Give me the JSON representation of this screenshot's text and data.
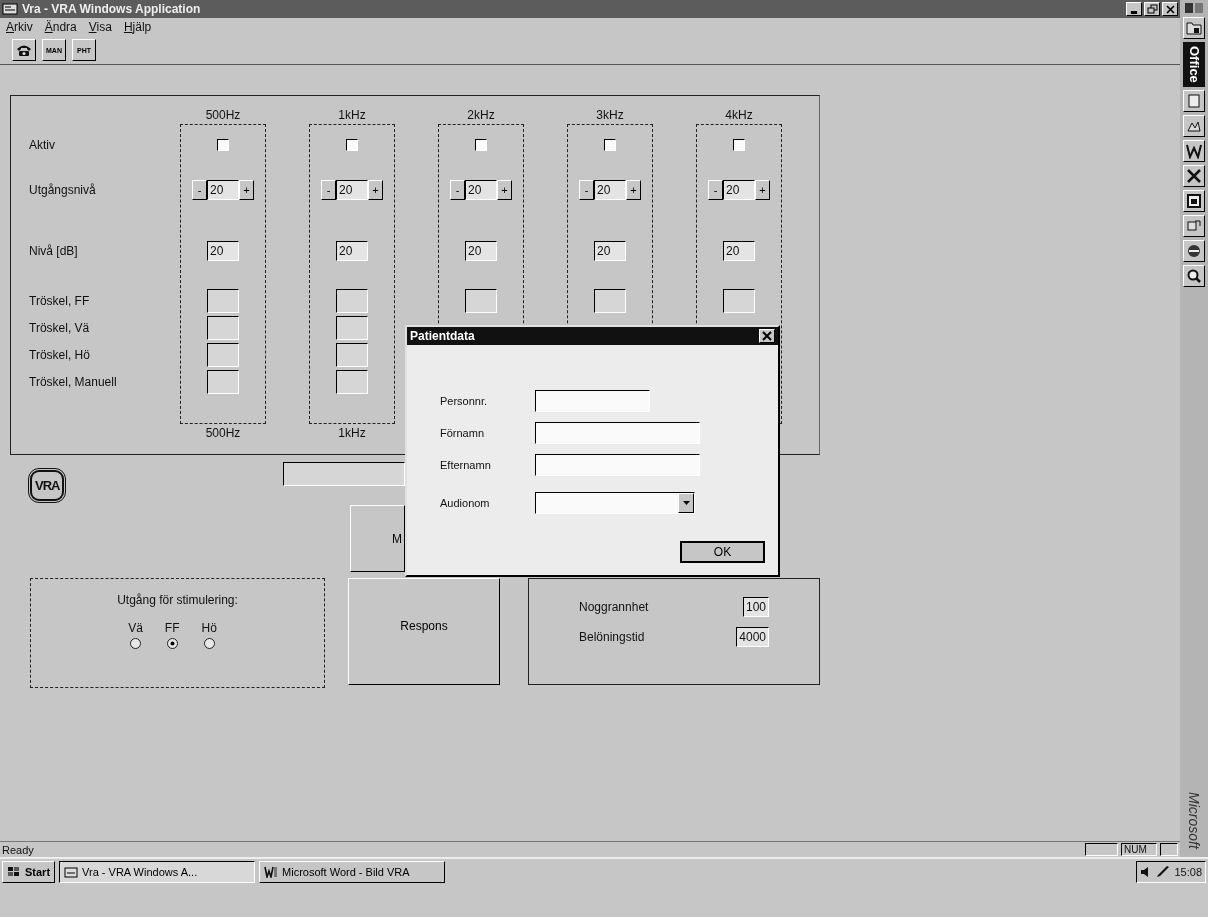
{
  "window": {
    "title": "Vra - VRA Windows Application"
  },
  "menu": [
    "Arkiv",
    "Ändra",
    "Visa",
    "Hjälp"
  ],
  "toolbar": [
    {
      "kind": "phone"
    },
    {
      "kind": "text",
      "label": "MAN"
    },
    {
      "kind": "text",
      "label": "PHT"
    }
  ],
  "grid": {
    "row_labels": [
      "Aktiv",
      "Utgångsnivå",
      "Nivå [dB]",
      "Tröskel, FF",
      "Tröskel, Vä",
      "Tröskel, Hö",
      "Tröskel, Manuell"
    ],
    "columns": [
      {
        "header": "500Hz",
        "active": false,
        "minus": "-",
        "output": "20",
        "plus": "+",
        "db": "20",
        "thresholds": [
          {
            "kind": "field"
          },
          {
            "kind": "field"
          },
          {
            "kind": "field"
          },
          {
            "kind": "field"
          }
        ],
        "footer": "500Hz"
      },
      {
        "header": "1kHz",
        "active": false,
        "minus": "-",
        "output": "20",
        "plus": "+",
        "db": "20",
        "thresholds": [
          {
            "kind": "field"
          },
          {
            "kind": "field"
          },
          {
            "kind": "field"
          },
          {
            "kind": "field"
          }
        ],
        "footer": "1kHz"
      },
      {
        "header": "2kHz",
        "active": false,
        "minus": "-",
        "output": "20",
        "plus": "+",
        "db": "20",
        "thresholds": [
          {
            "kind": "field"
          }
        ]
      },
      {
        "header": "3kHz",
        "active": false,
        "minus": "-",
        "output": "20",
        "plus": "+",
        "db": "20",
        "thresholds": [
          {
            "kind": "field"
          }
        ]
      },
      {
        "header": "4kHz",
        "active": false,
        "minus": "-",
        "output": "20",
        "plus": "+",
        "db": "20",
        "thresholds": [
          {
            "kind": "field"
          }
        ]
      }
    ]
  },
  "logo": "VRA",
  "partial_button": "M",
  "stimulation": {
    "title": "Utgång för stimulering:",
    "options": [
      {
        "label": "Vä",
        "selected": false
      },
      {
        "label": "FF",
        "selected": true
      },
      {
        "label": "Hö",
        "selected": false
      }
    ]
  },
  "respons_button": "Respons",
  "settings": [
    {
      "label": "Noggrannhet",
      "value": "100"
    },
    {
      "label": "Belöningstid",
      "value": "4000"
    }
  ],
  "dialog": {
    "title": "Patientdata",
    "fields": [
      {
        "kind": "short",
        "label": "Personnr."
      },
      {
        "kind": "text",
        "label": "Förnamn"
      },
      {
        "kind": "text",
        "label": "Efternamn"
      },
      {
        "kind": "dropdown",
        "label": "Audionom"
      }
    ],
    "ok": "OK"
  },
  "status_bar": {
    "text": "Ready",
    "indicator": "NUM"
  },
  "taskbar": {
    "start": "Start",
    "tasks": [
      {
        "kind": "app",
        "label": "Vra - VRA Windows A...",
        "selected": true
      },
      {
        "kind": "word",
        "label": "Microsoft Word - Bild VRA",
        "selected": false
      }
    ],
    "clock": "15:08"
  },
  "office_bar": {
    "title": "Office",
    "brand": "Microsoft"
  }
}
